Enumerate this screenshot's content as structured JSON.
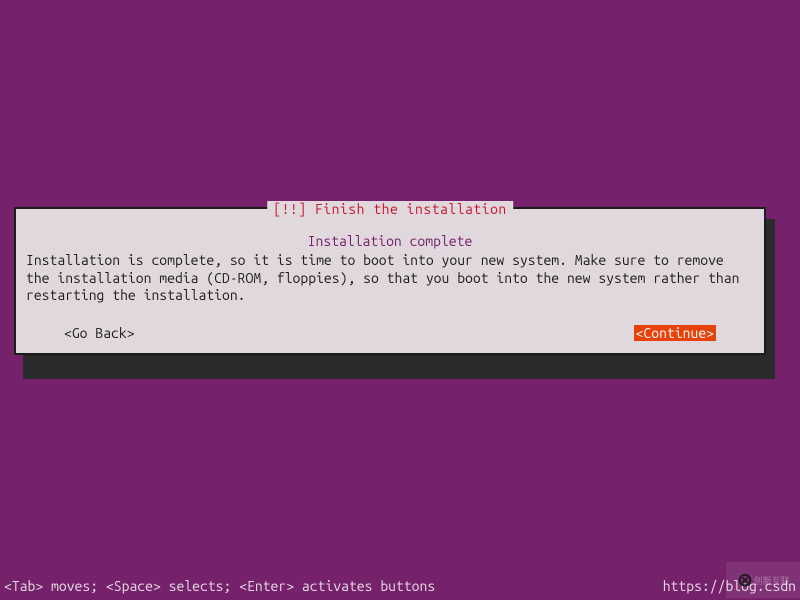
{
  "dialog": {
    "frame_title": "[!!] Finish the installation",
    "subtitle": "Installation complete",
    "body": "Installation is complete, so it is time to boot into your new system. Make sure to remove the installation media (CD-ROM, floppies), so that you boot into the new system rather than restarting the installation.",
    "go_back_label": "<Go Back>",
    "continue_label": "<Continue>"
  },
  "status_bar": {
    "help_text": "<Tab> moves; <Space> selects; <Enter> activates buttons",
    "source_url": "https://blog.csdn"
  },
  "watermark": {
    "text": "创新互联"
  }
}
